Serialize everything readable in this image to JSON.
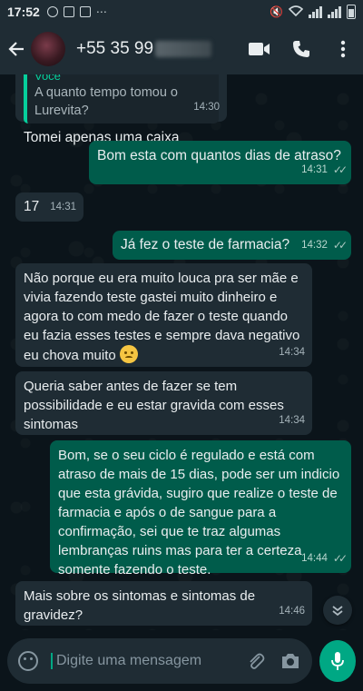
{
  "status_bar": {
    "time": "17:52"
  },
  "header": {
    "contact_name": "+55 35 99"
  },
  "messages": [
    {
      "direction": "in",
      "quote_author": "Você",
      "quote_text": "A quanto tempo tomou o Lurevita?",
      "text": "Tomei apenas uma caixa",
      "time": "14:30"
    },
    {
      "direction": "out",
      "text": "Bom esta com quantos dias de atraso?",
      "time": "14:31"
    },
    {
      "direction": "in",
      "text": "17",
      "time": "14:31"
    },
    {
      "direction": "out",
      "text": "Já fez o teste de farmacia?",
      "time": "14:32"
    },
    {
      "direction": "in",
      "text": "Não porque eu era muito louca pra ser mãe e vivia fazendo teste gastei muito dinheiro e agora to com medo de fazer o teste quando eu fazia esses testes e sempre dava negativo eu chova muito",
      "emoji": "disappointed-face",
      "time": "14:34"
    },
    {
      "direction": "in",
      "text": "Queria saber antes de fazer se tem possibilidade e eu estar gravida com esses sintomas",
      "time": "14:34"
    },
    {
      "direction": "out",
      "text": "Bom, se o seu ciclo é regulado e está com atraso de mais de 15 dias, pode ser um indicio que esta grávida, sugiro que realize o teste de farmacia e após o de sangue para a confirmação, sei que te traz algumas lembranças ruins mas para ter a certeza somente fazendo o teste.",
      "time": "14:44"
    },
    {
      "direction": "in",
      "text": "Mais sobre os sintomas e sintomas de gravidez?",
      "time": "14:46"
    }
  ],
  "composer": {
    "placeholder": "Digite uma mensagem"
  },
  "colors": {
    "incoming": "#1f2c34",
    "outgoing": "#005c4b",
    "accent": "#00a884",
    "read_ticks": "#53bdeb"
  }
}
